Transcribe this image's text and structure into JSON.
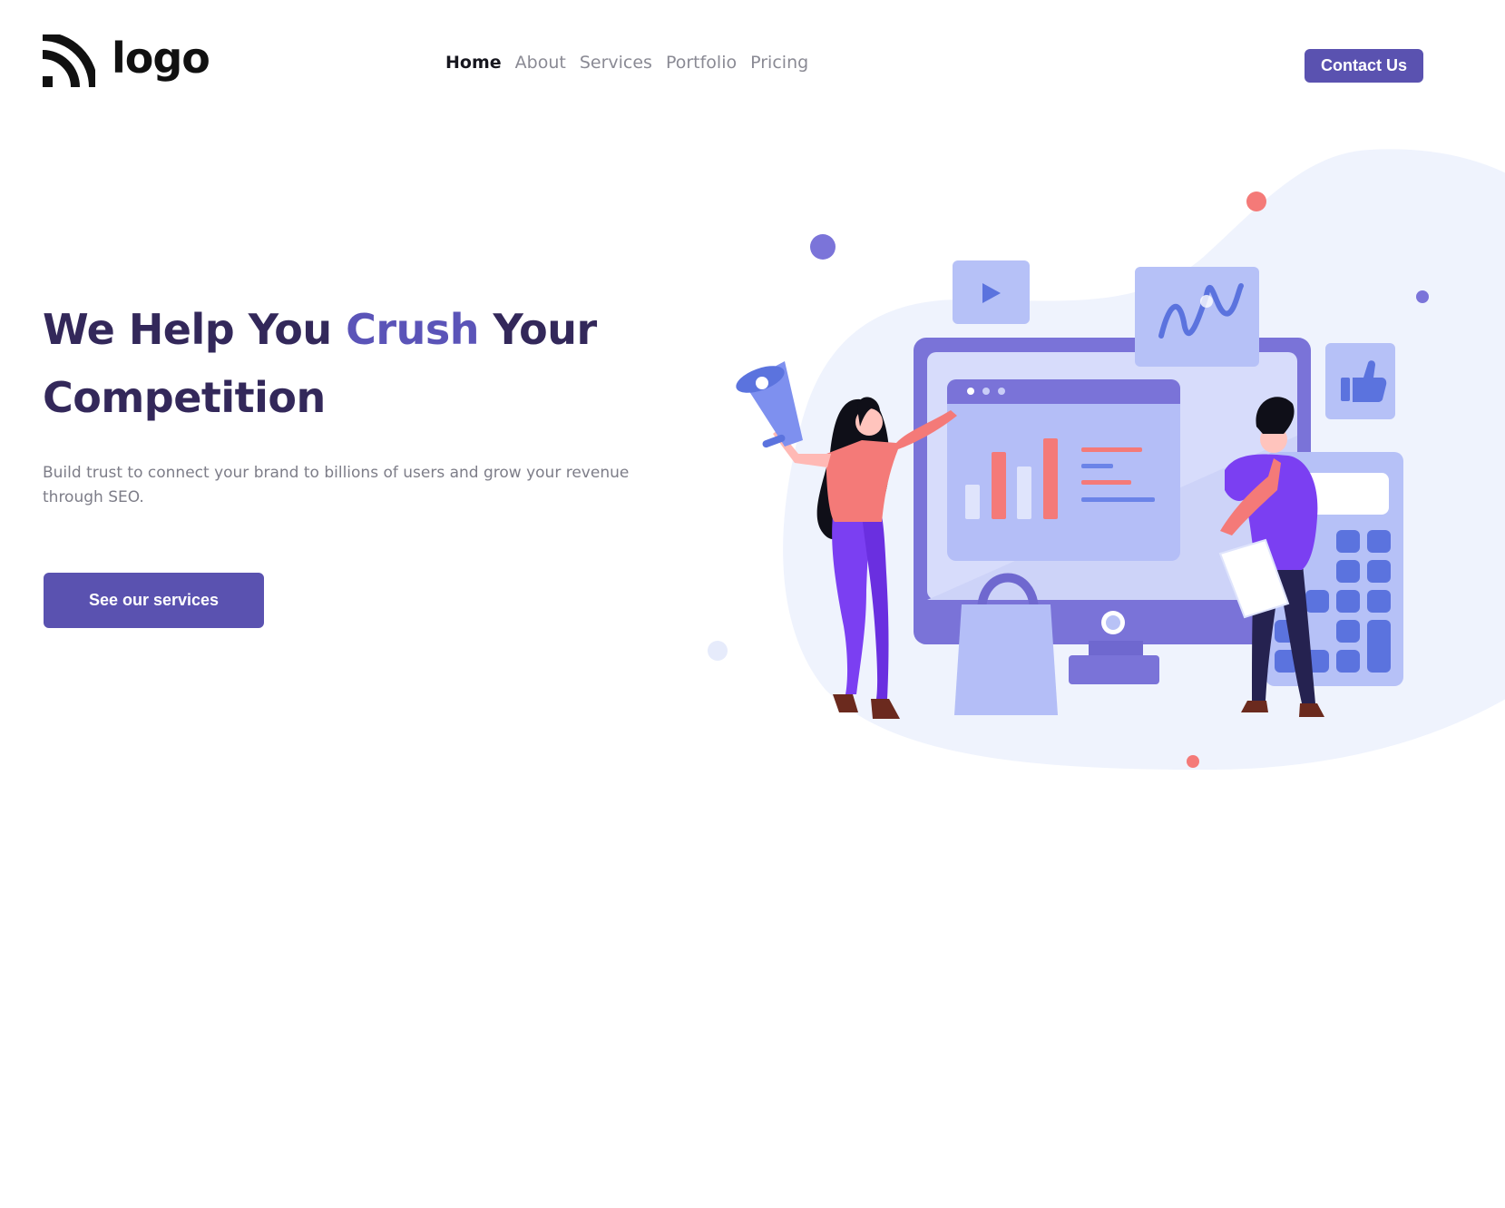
{
  "brand": {
    "logo_text": "logo",
    "logo_icon": "signal-arcs-icon"
  },
  "nav": {
    "items": [
      {
        "label": "Home",
        "active": true
      },
      {
        "label": "About",
        "active": false
      },
      {
        "label": "Services",
        "active": false
      },
      {
        "label": "Portfolio",
        "active": false
      },
      {
        "label": "Pricing",
        "active": false
      }
    ]
  },
  "header": {
    "contact_label": "Contact Us"
  },
  "hero": {
    "title_part1": "We Help You ",
    "title_accent": "Crush",
    "title_part2": " Your Competition",
    "subtitle": "Build trust to connect your brand to billions of users and grow your revenue through SEO.",
    "cta_label": "See our services"
  },
  "colors": {
    "primary": "#5a52b0",
    "heading": "#33285a",
    "accent_text": "#5b54b8",
    "body_text": "#7d7d88",
    "blob": "#eff3fd",
    "coral": "#f47a78"
  },
  "illustration": {
    "icons": [
      "play-icon",
      "thumbs-up-icon",
      "megaphone-icon",
      "shopping-bag-icon",
      "calculator-icon",
      "analytics-monitor-icon"
    ]
  }
}
